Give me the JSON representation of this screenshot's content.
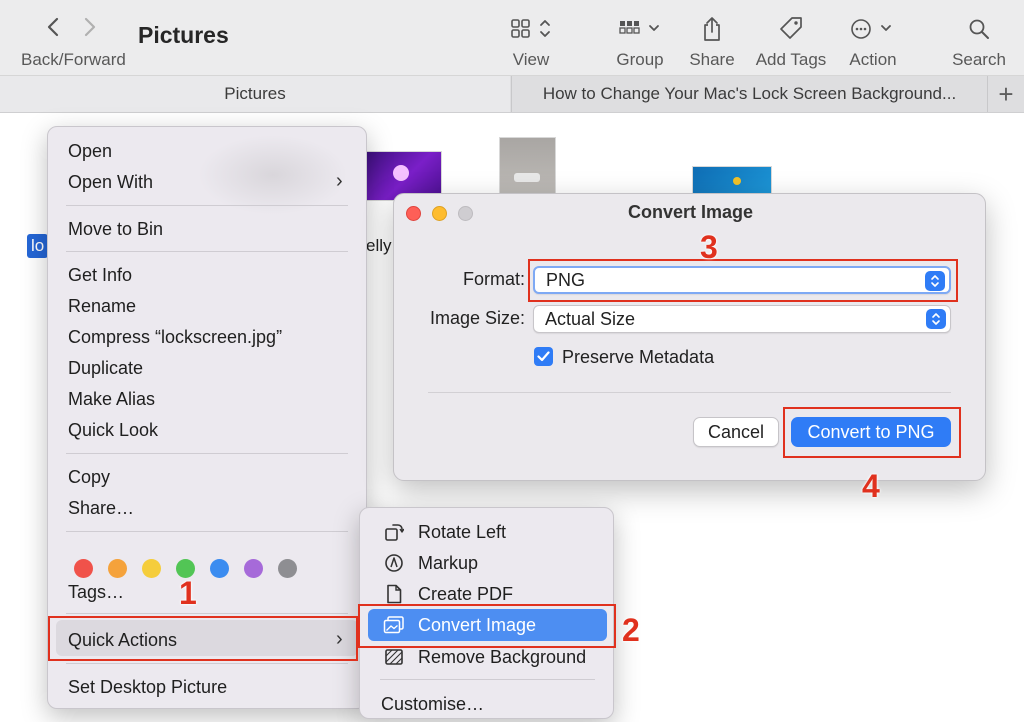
{
  "toolbar": {
    "back_forward_label": "Back/Forward",
    "window_title": "Pictures",
    "buttons": [
      {
        "label": "View",
        "icon": "grid-view-icon"
      },
      {
        "label": "Group",
        "icon": "group-icon"
      },
      {
        "label": "Share",
        "icon": "share-icon"
      },
      {
        "label": "Add Tags",
        "icon": "tag-icon"
      },
      {
        "label": "Action",
        "icon": "ellipsis-circle-icon"
      },
      {
        "label": "Search",
        "icon": "search-icon"
      }
    ]
  },
  "tabs": {
    "active": "Pictures",
    "second": "How to Change Your Mac's Lock Screen Background...",
    "add": "+"
  },
  "files": {
    "selected_label": "lo",
    "partial_label": "elly"
  },
  "context_menu": {
    "items": [
      "Open",
      "Open With",
      "Move to Bin",
      "Get Info",
      "Rename",
      "Compress “lockscreen.jpg”",
      "Duplicate",
      "Make Alias",
      "Quick Look",
      "Copy",
      "Share…",
      "Tags…",
      "Quick Actions",
      "Set Desktop Picture"
    ],
    "tag_colors": [
      "#f0524a",
      "#f5a23b",
      "#f5cd3b",
      "#52c555",
      "#3b8cf0",
      "#a66ad9",
      "#8e8e92"
    ]
  },
  "submenu": {
    "items": [
      {
        "label": "Rotate Left",
        "icon": "rotate-left-icon"
      },
      {
        "label": "Markup",
        "icon": "markup-icon"
      },
      {
        "label": "Create PDF",
        "icon": "document-icon"
      },
      {
        "label": "Convert Image",
        "icon": "convert-image-icon"
      },
      {
        "label": "Remove Background",
        "icon": "remove-background-icon"
      },
      {
        "label": "Customise…",
        "icon": ""
      }
    ],
    "highlighted": "Convert Image"
  },
  "dialog": {
    "title": "Convert Image",
    "format_label": "Format:",
    "format_value": "PNG",
    "size_label": "Image Size:",
    "size_value": "Actual Size",
    "preserve_label": "Preserve Metadata",
    "preserve_checked": true,
    "cancel_label": "Cancel",
    "convert_label": "Convert to PNG"
  },
  "annotations": {
    "steps": [
      "1",
      "2",
      "3",
      "4"
    ],
    "color": "#e0311e"
  },
  "colors": {
    "accent": "#2f7cf6",
    "menu_bg": "#ece9ef",
    "highlight": "#4d8ef2"
  }
}
